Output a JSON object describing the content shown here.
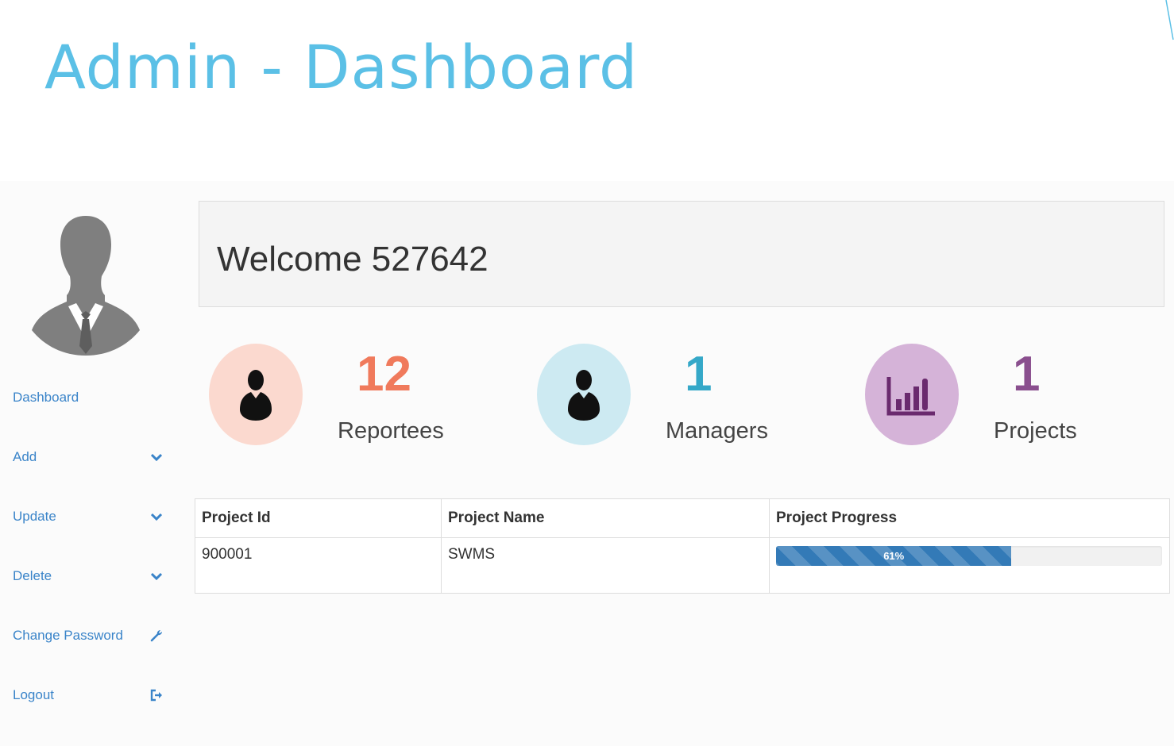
{
  "title": "Admin - Dashboard",
  "sidebar": {
    "items": [
      {
        "label": "Dashboard",
        "icon": ""
      },
      {
        "label": "Add",
        "icon": "chevron-down-icon"
      },
      {
        "label": "Update",
        "icon": "chevron-down-icon"
      },
      {
        "label": "Delete",
        "icon": "chevron-down-icon"
      },
      {
        "label": "Change Password",
        "icon": "wrench-icon"
      },
      {
        "label": "Logout",
        "icon": "logout-icon"
      }
    ]
  },
  "welcome": "Welcome 527642",
  "stats": [
    {
      "count": "12",
      "label": "Reportees",
      "color": "#f07a5c",
      "bg": "#fbd9cf",
      "icon": "user-icon"
    },
    {
      "count": "1",
      "label": "Managers",
      "color": "#35a8c8",
      "bg": "#cdeaf2",
      "icon": "user-icon"
    },
    {
      "count": "1",
      "label": "Projects",
      "color": "#8a4f8e",
      "bg": "#d5b3d8",
      "icon": "bar-chart-icon"
    }
  ],
  "table": {
    "headers": [
      "Project Id",
      "Project Name",
      "Project Progress"
    ],
    "rows": [
      {
        "id": "900001",
        "name": "SWMS",
        "progress": 61,
        "progress_label": "61%"
      }
    ]
  },
  "colors": {
    "title": "#5bc0e6",
    "nav": "#3a84c9",
    "progress": "#337ab7"
  }
}
